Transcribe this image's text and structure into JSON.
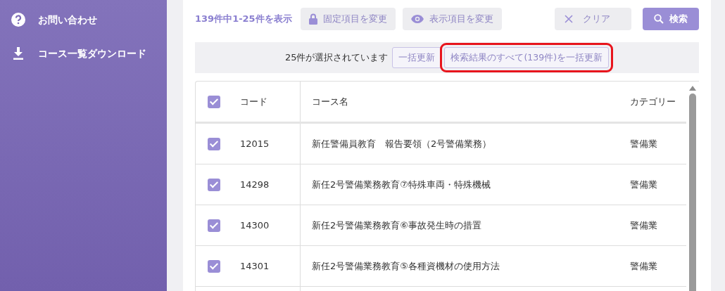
{
  "sidebar": {
    "items": [
      {
        "kind": "help",
        "label": "お問い合わせ"
      },
      {
        "kind": "download",
        "label": "コース一覧ダウンロード"
      }
    ]
  },
  "toolbar": {
    "summary": "139件中1-25件を表示",
    "buttons": [
      {
        "kind": "lock",
        "label": "固定項目を変更"
      },
      {
        "kind": "eye",
        "label": "表示項目を変更"
      }
    ],
    "clear": {
      "label": "クリア"
    },
    "search": {
      "label": "検索"
    }
  },
  "selection_bar": {
    "text": "25件が選択されています",
    "buttons": [
      {
        "label": "一括更新",
        "highlighted": false
      },
      {
        "label": "検索結果のすべて(139件)を一括更新",
        "highlighted": true
      }
    ]
  },
  "table": {
    "header_checked": true,
    "columns": [
      "コード",
      "コース名",
      "カテゴリー"
    ],
    "rows": [
      {
        "checked": true,
        "cells": [
          "12015",
          "新任警備員教育　報告要領（2号警備業務）",
          "警備業"
        ]
      },
      {
        "checked": true,
        "cells": [
          "14298",
          "新任2号警備業務教育⑦特殊車両・特殊機械",
          "警備業"
        ]
      },
      {
        "checked": true,
        "cells": [
          "14300",
          "新任2号警備業務教育⑥事故発生時の措置",
          "警備業"
        ]
      },
      {
        "checked": true,
        "cells": [
          "14301",
          "新任2号警備業務教育⑤各種資機材の使用方法",
          "警備業"
        ]
      }
    ]
  }
}
